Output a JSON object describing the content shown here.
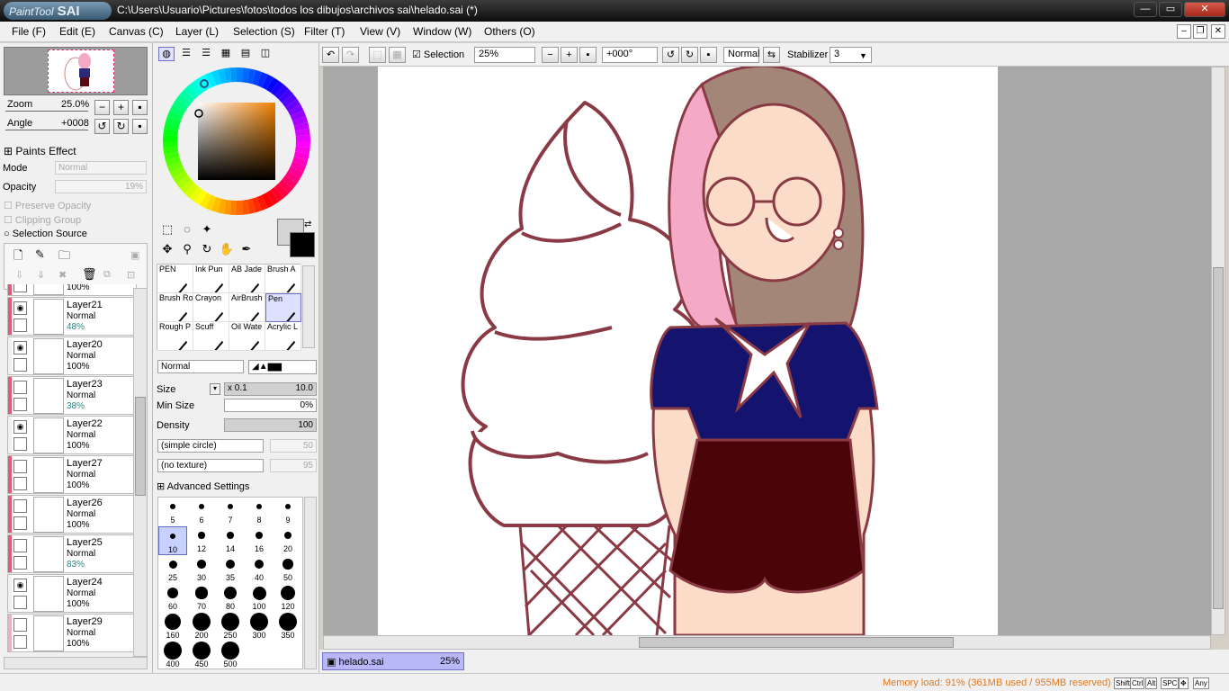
{
  "window": {
    "app_logo": "PaintTool",
    "app_logo_bold": "SAI",
    "title": "C:\\Users\\Usuario\\Pictures\\fotos\\todos los dibujos\\archivos sai\\helado.sai (*)",
    "minimize": "—",
    "restore": "▭",
    "close": "✕"
  },
  "menu": [
    "File (F)",
    "Edit (E)",
    "Canvas (C)",
    "Layer (L)",
    "Selection (S)",
    "Filter (T)",
    "View (V)",
    "Window (W)",
    "Others (O)"
  ],
  "navigator": {
    "zoom_label": "Zoom",
    "zoom_value": "25.0%",
    "angle_label": "Angle",
    "angle_value": "+0008"
  },
  "paints_effect": {
    "header": "Paints Effect",
    "mode_label": "Mode",
    "mode_value": "Normal",
    "opacity_label": "Opacity",
    "opacity_value": "19%",
    "preserve_opacity": "Preserve Opacity",
    "clipping_group": "Clipping Group",
    "selection_source": "Selection Source"
  },
  "layers": [
    {
      "name": "",
      "mode": "",
      "opacity": "100%",
      "strip": "#e05a7a",
      "eye": false,
      "partial": true
    },
    {
      "name": "Layer21",
      "mode": "Normal",
      "opacity": "48%",
      "strip": "#e05a7a",
      "eye": true,
      "low": true
    },
    {
      "name": "Layer20",
      "mode": "Normal",
      "opacity": "100%",
      "strip": "#f0f0f0",
      "eye": true
    },
    {
      "name": "Layer23",
      "mode": "Normal",
      "opacity": "38%",
      "strip": "#e05a7a",
      "eye": false,
      "low": true
    },
    {
      "name": "Layer22",
      "mode": "Normal",
      "opacity": "100%",
      "strip": "#f0f0f0",
      "eye": true
    },
    {
      "name": "Layer27",
      "mode": "Normal",
      "opacity": "100%",
      "strip": "#e05a7a",
      "eye": false
    },
    {
      "name": "Layer26",
      "mode": "Normal",
      "opacity": "100%",
      "strip": "#e05a7a",
      "eye": false
    },
    {
      "name": "Layer25",
      "mode": "Normal",
      "opacity": "83%",
      "strip": "#e05a7a",
      "eye": false,
      "low": true
    },
    {
      "name": "Layer24",
      "mode": "Normal",
      "opacity": "100%",
      "strip": "#f0f0f0",
      "eye": true
    },
    {
      "name": "Layer29",
      "mode": "Normal",
      "opacity": "100%",
      "strip": "#e9b0c8",
      "eye": false
    }
  ],
  "brush_tools": [
    [
      "PEN",
      "Ink Pun",
      "AB Jade",
      "Brush A"
    ],
    [
      "Brush Ro",
      "Crayon",
      "AirBrush",
      "Pen"
    ],
    [
      "Rough P",
      "Scuff",
      "Oil Wate",
      "Acrylic L"
    ]
  ],
  "brush": {
    "blend_mode": "Normal",
    "size_label": "Size",
    "size_mult": "x 0.1",
    "size_value": "10.0",
    "min_size_label": "Min Size",
    "min_size_value": "0%",
    "density_label": "Density",
    "density_value": "100",
    "shape": "(simple circle)",
    "shape_value": "50",
    "texture": "(no texture)",
    "texture_value": "95",
    "advanced": "Advanced Settings"
  },
  "brush_sizes": [
    "5",
    "6",
    "7",
    "8",
    "9",
    "10",
    "12",
    "14",
    "16",
    "20",
    "25",
    "30",
    "35",
    "40",
    "50",
    "60",
    "70",
    "80",
    "100",
    "120",
    "160",
    "200",
    "250",
    "300",
    "350",
    "400",
    "450",
    "500"
  ],
  "toolbar": {
    "selection_label": "Selection",
    "zoom_value": "25%",
    "angle_value": "+000°",
    "mode_value": "Normal",
    "stabilizer_label": "Stabilizer",
    "stabilizer_value": "3"
  },
  "document_tab": {
    "name": "helado.sai",
    "zoom": "25%"
  },
  "status": {
    "memory": "Memory load: 91% (361MB used / 955MB reserved)",
    "keys": [
      "Shift",
      "Ctrl",
      "Alt",
      "SPC",
      "✥",
      "Any"
    ]
  },
  "colors": {
    "accent": "#e05a7a",
    "primary_color": "#000000",
    "secondary_color": "#d4d4d4",
    "memory_text": "#e07a20"
  }
}
